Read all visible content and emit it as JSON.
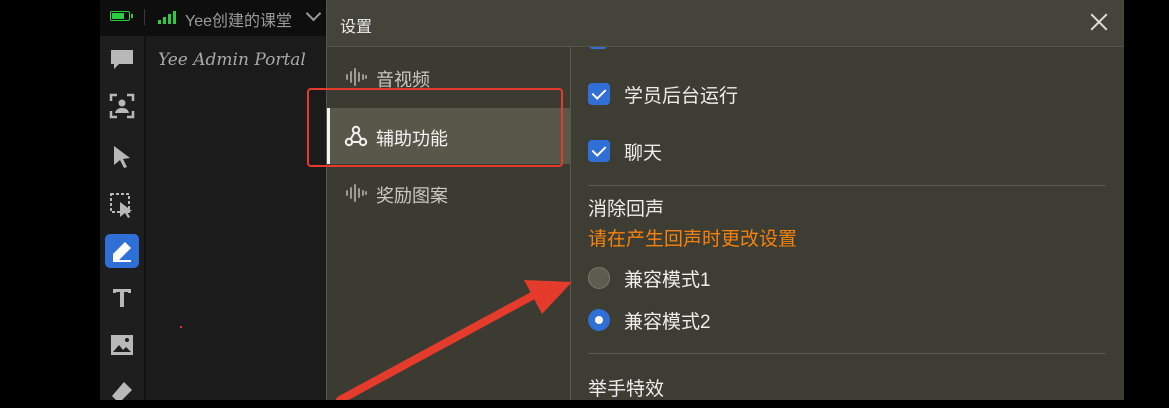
{
  "topbar": {
    "course_title": "Yee创建的课堂",
    "icons": [
      "battery-icon",
      "signal-icon",
      "chevron-down-icon"
    ]
  },
  "toolbar": {
    "tools": [
      "chat-icon",
      "person-frame-icon",
      "pointer-icon",
      "select-area-icon",
      "pen-icon",
      "text-icon",
      "image-icon",
      "eraser-icon"
    ],
    "active_tool": "pen-icon"
  },
  "canvas": {
    "watermark": "Yee Admin Portal"
  },
  "dialog": {
    "title": "设置",
    "nav": [
      {
        "label": "音视频",
        "icon": "audio-wave-icon",
        "selected": false
      },
      {
        "label": "辅助功能",
        "icon": "network-nodes-icon",
        "selected": true
      },
      {
        "label": "奖励图案",
        "icon": "audio-wave-icon",
        "selected": false
      }
    ],
    "content": {
      "checkboxes": [
        {
          "label": "学员后台运行",
          "checked": true
        },
        {
          "label": "聊天",
          "checked": true
        }
      ],
      "echo": {
        "title": "消除回声",
        "hint": "请在产生回声时更改设置",
        "options": [
          {
            "label": "兼容模式1",
            "selected": false
          },
          {
            "label": "兼容模式2",
            "selected": true
          }
        ]
      },
      "next_section_title": "举手特效"
    }
  },
  "colors": {
    "accent": "#2f6fd6",
    "warning": "#f5820c",
    "annotation": "#e53b2c",
    "dialog_bg": "#3d3d33"
  }
}
